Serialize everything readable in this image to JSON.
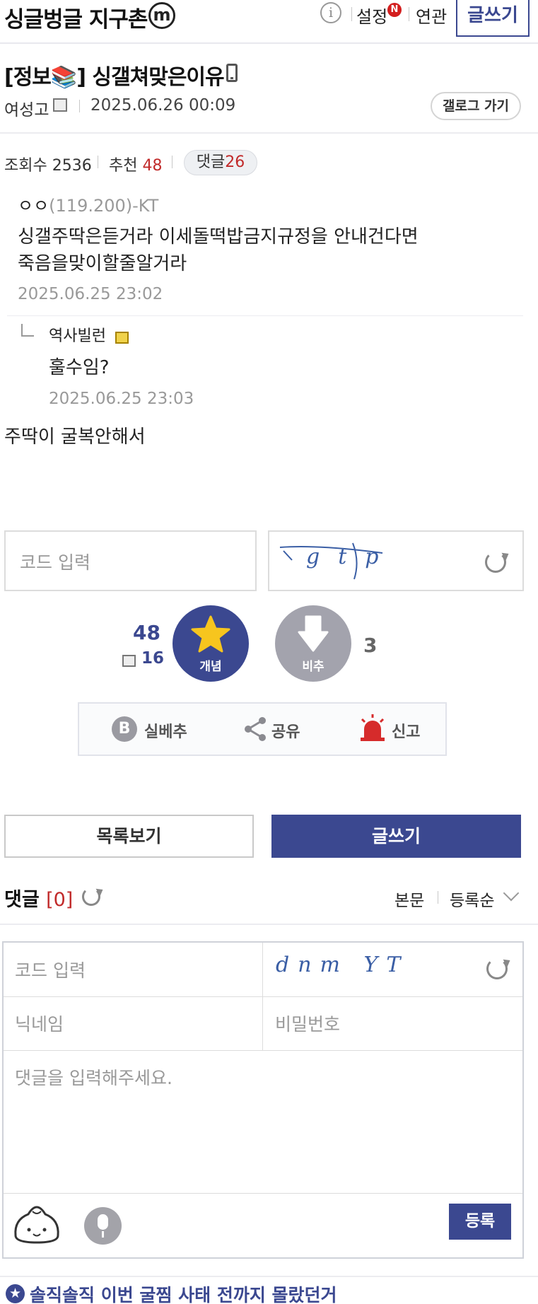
{
  "header": {
    "gallery_title": "싱글벙글 지구촌",
    "m_badge": "m",
    "settings_label": "설정",
    "new_badge": "N",
    "related_label": "연관",
    "write_label": "글쓰기"
  },
  "post": {
    "title": "[정보📚] 싱갤쳐맞은이유",
    "author": "여성고",
    "date": "2025.06.26 00:09",
    "gallog_button": "갤로그 가기",
    "views_label": "조회수",
    "views": "2536",
    "recommend_label": "추천",
    "recommend": "48",
    "comments_label": "댓글",
    "comments": "26",
    "quote": {
      "author": "ㅇㅇ",
      "ip": "(119.200)-KT",
      "line1": "싱갤주딱은듣거라 이세돌떡밥금지규정을 안내건다면",
      "line2": "죽음을맞이할줄알거라",
      "date": "2025.06.25 23:02"
    },
    "reply": {
      "author": "역사빌런",
      "text": "훌수임?",
      "date": "2025.06.25 23:03"
    },
    "body": "주딱이 굴복안해서"
  },
  "captcha_top": {
    "placeholder": "코드 입력",
    "text": "gtp"
  },
  "vote": {
    "up_count": "48",
    "fix_count": "16",
    "up_label": "개념",
    "down_label": "비추",
    "down_count": "3"
  },
  "share": {
    "best_label": "실베추",
    "best_icon_letter": "B",
    "share_label": "공유",
    "report_label": "신고"
  },
  "buttons": {
    "list_label": "목록보기",
    "write_label": "글쓰기"
  },
  "comments": {
    "title": "댓글",
    "count": "[0]",
    "sort_body": "본문",
    "sort_order": "등록순"
  },
  "comment_form": {
    "code_placeholder": "코드 입력",
    "captcha_text": "dnm YT",
    "nickname_placeholder": "닉네임",
    "password_placeholder": "비밀번호",
    "comment_placeholder": "댓글을 입력해주세요.",
    "submit_label": "등록"
  },
  "bottom": {
    "next_post": "솔직솔직 이번 굴찜 사태 전까지 몰랐던거"
  },
  "colors": {
    "brand": "#3b4890",
    "accent_red": "#c12a2a",
    "star_yellow": "#f7c51e",
    "downvote_gray": "#a3a3ad"
  }
}
